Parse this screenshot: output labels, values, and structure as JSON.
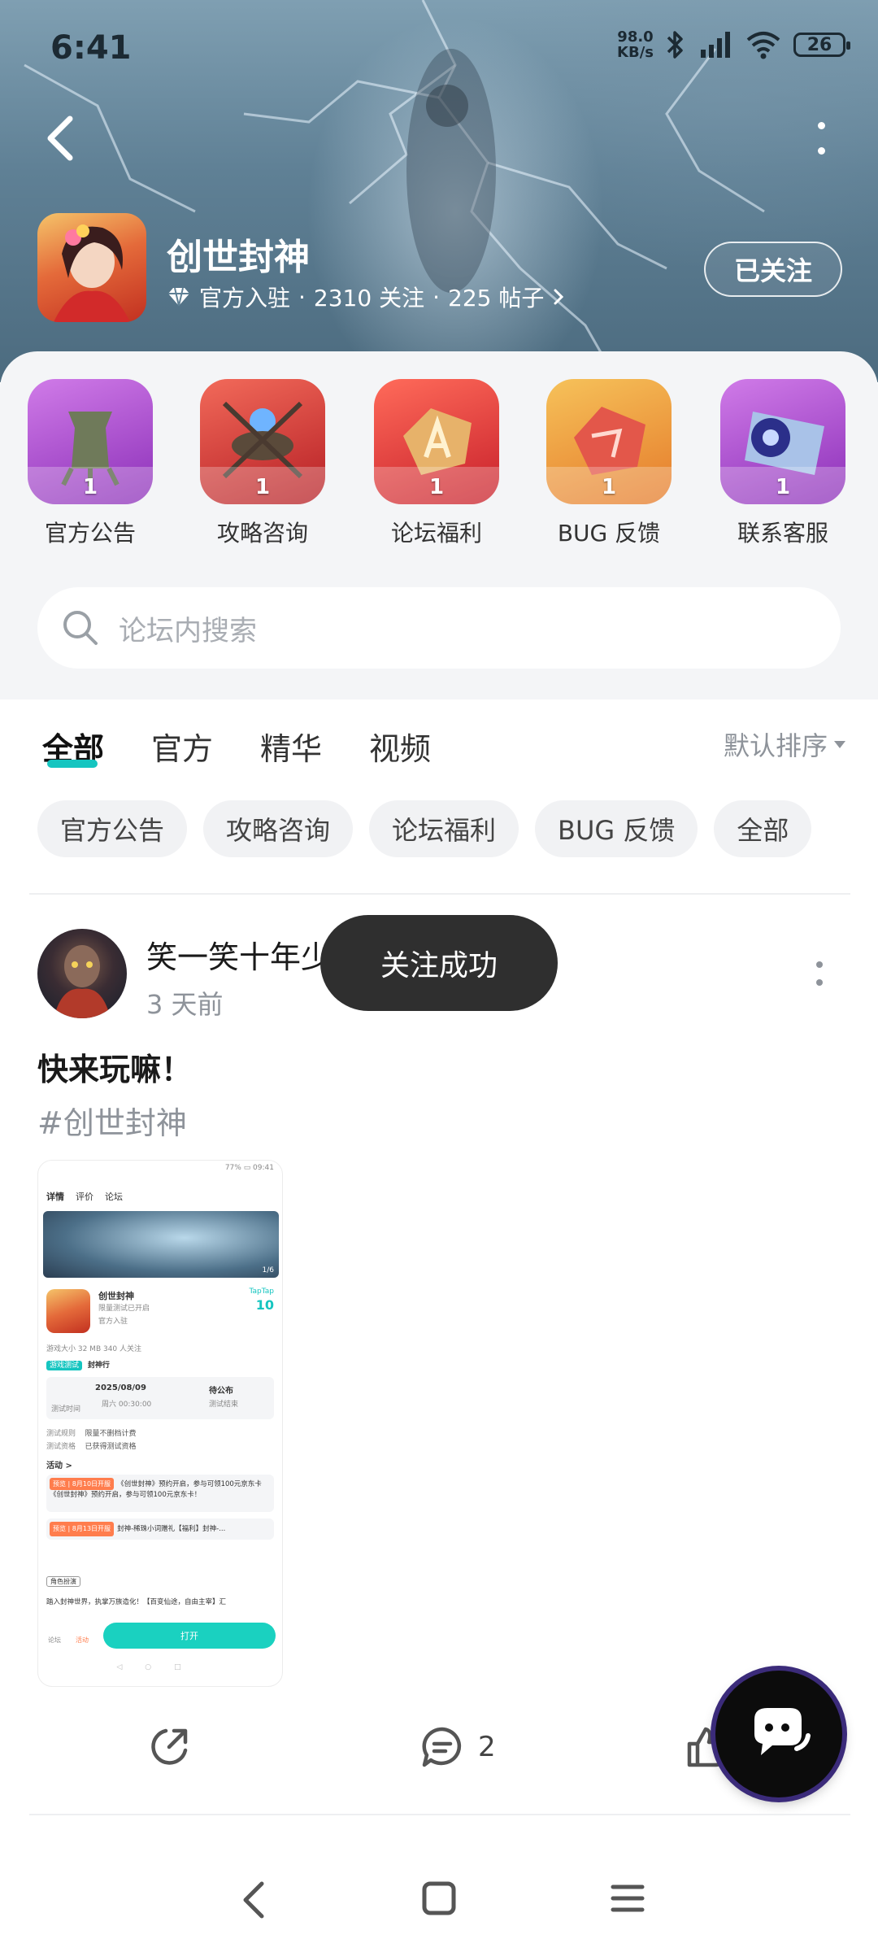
{
  "status_bar": {
    "time": "6:41",
    "net_speed_value": "98.0",
    "net_speed_unit": "KB/s",
    "battery": "26"
  },
  "header": {
    "game_name": "创世封神",
    "official_label": "官方入驻",
    "followers": "2310 关注",
    "posts": "225 帖子",
    "separator": "·",
    "follow_button": "已关注"
  },
  "categories": [
    {
      "label": "官方公告",
      "count": "1"
    },
    {
      "label": "攻略咨询",
      "count": "1"
    },
    {
      "label": "论坛福利",
      "count": "1"
    },
    {
      "label": "BUG 反馈",
      "count": "1"
    },
    {
      "label": "联系客服",
      "count": "1"
    }
  ],
  "search": {
    "placeholder": "论坛内搜索"
  },
  "tabs": [
    "全部",
    "官方",
    "精华",
    "视频"
  ],
  "sort_label": "默认排序",
  "chips": [
    "官方公告",
    "攻略咨询",
    "论坛福利",
    "BUG 反馈",
    "全部"
  ],
  "post": {
    "author": "笑一笑十年少",
    "time": "3 天前",
    "title": "快来玩嘛！",
    "tag": "#创世封神",
    "comment_count": "2"
  },
  "toast": "关注成功",
  "nested_screenshot": {
    "status_left": "77% ▭ 09:41",
    "tabs": [
      "详情",
      "评价",
      "论坛"
    ],
    "page_counter": "1/6",
    "game_name": "创世封神",
    "game_sub": "限量测试已开启",
    "official": "官方入驻",
    "brand": "TapTap",
    "score": "10",
    "size_info": "游戏大小 32 MB   340 人关注",
    "test_badge": "游戏测试",
    "test_name": "封神行",
    "test_date": "2025/08/09",
    "test_time": "周六 00:30:00",
    "test_end": "待公布",
    "test_end_label": "测试结束",
    "test_start_label": "测试时间",
    "rule_label": "测试规则",
    "rule_value": "限量不删档计费",
    "qual_label": "测试资格",
    "qual_value": "已获得测试资格",
    "activity_header": "活动 >",
    "activity_1_badge": "预览 | 8月10日开服",
    "activity_1_text": "《创世封神》预约开启，参与可领100元京东卡《创世封神》预约开启，参与可领100元京东卡！",
    "activity_2_badge": "预览 | 8月13日开服",
    "activity_2_text": "封神-稀珠小词赠礼【福利】封神-...",
    "role_badge": "角色扮演",
    "intro": "踏入封神世界，执掌万族造化！【百变仙途，自由主宰】汇",
    "bottom_left_1": "论坛",
    "bottom_left_2": "活动",
    "open_button": "打开"
  },
  "colors": {
    "accent": "#15c5c0",
    "toast_bg": "#2f2f2f",
    "panel_bg": "#f4f5f7",
    "chip_bg": "#f1f2f4",
    "muted_text": "#8e939a"
  },
  "icons": [
    "back-icon",
    "more-icon",
    "diamond-icon",
    "chevron-right-icon",
    "search-icon",
    "caret-down-icon",
    "share-icon",
    "comment-icon",
    "like-icon",
    "chat-bubble-icon",
    "nav-back-icon",
    "nav-home-icon",
    "nav-menu-icon",
    "bluetooth-icon",
    "signal-icon",
    "wifi-icon",
    "battery-icon"
  ]
}
